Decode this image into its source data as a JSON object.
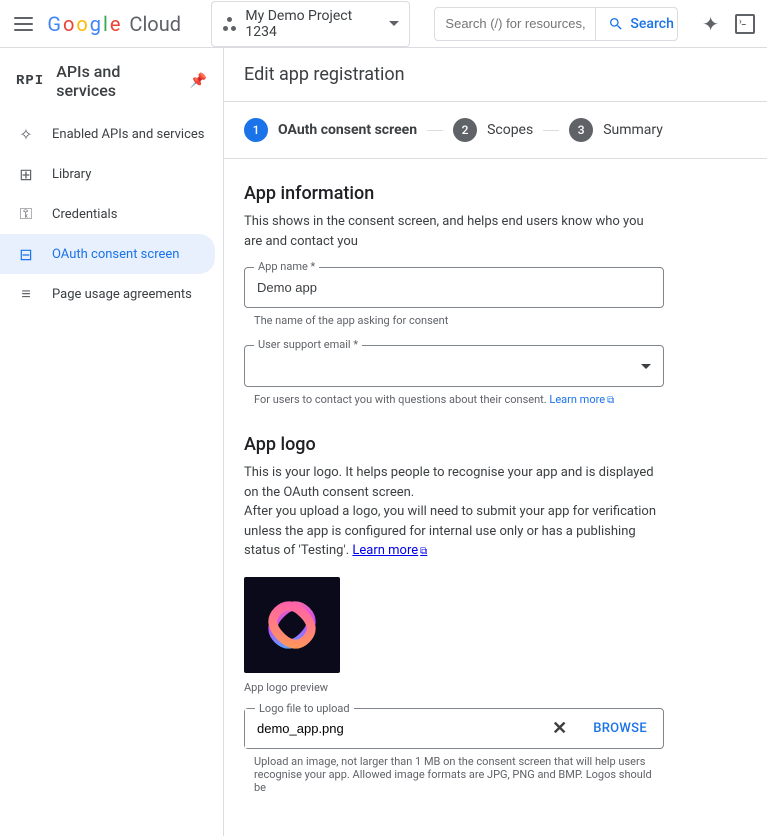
{
  "topbar": {
    "logo_text": "Google Cloud",
    "project_name": "My Demo Project 1234",
    "search_placeholder": "Search (/) for resources, d…",
    "search_button": "Search"
  },
  "sidebar": {
    "title": "APIs and services",
    "items": [
      {
        "label": "Enabled APIs and services",
        "icon": "diamond"
      },
      {
        "label": "Library",
        "icon": "library"
      },
      {
        "label": "Credentials",
        "icon": "key"
      },
      {
        "label": "OAuth consent screen",
        "icon": "consent"
      },
      {
        "label": "Page usage agreements",
        "icon": "agreements"
      }
    ]
  },
  "page": {
    "title": "Edit app registration"
  },
  "stepper": {
    "steps": [
      {
        "num": "1",
        "label": "OAuth consent screen",
        "active": true
      },
      {
        "num": "2",
        "label": "Scopes",
        "active": false
      },
      {
        "num": "3",
        "label": "Summary",
        "active": false
      }
    ]
  },
  "app_info": {
    "heading": "App information",
    "desc": "This shows in the consent screen, and helps end users know who you are and contact you",
    "app_name_label": "App name *",
    "app_name_value": "Demo app",
    "app_name_helper": "The name of the app asking for consent",
    "support_email_label": "User support email *",
    "support_email_value": "",
    "support_email_helper": "For users to contact you with questions about their consent. ",
    "learn_more": "Learn more"
  },
  "app_logo": {
    "heading": "App logo",
    "desc1": "This is your logo. It helps people to recognise your app and is displayed on the OAuth consent screen.",
    "desc2": "After you upload a logo, you will need to submit your app for verification unless the app is configured for internal use only or has a publishing status of 'Testing'. ",
    "learn_more": "Learn more",
    "preview_caption": "App logo preview",
    "upload_label": "Logo file to upload",
    "upload_value": "demo_app.png",
    "browse_label": "BROWSE",
    "upload_helper": "Upload an image, not larger than 1 MB on the consent screen that will help users recognise your app. Allowed image formats are JPG, PNG and BMP. Logos should be"
  }
}
